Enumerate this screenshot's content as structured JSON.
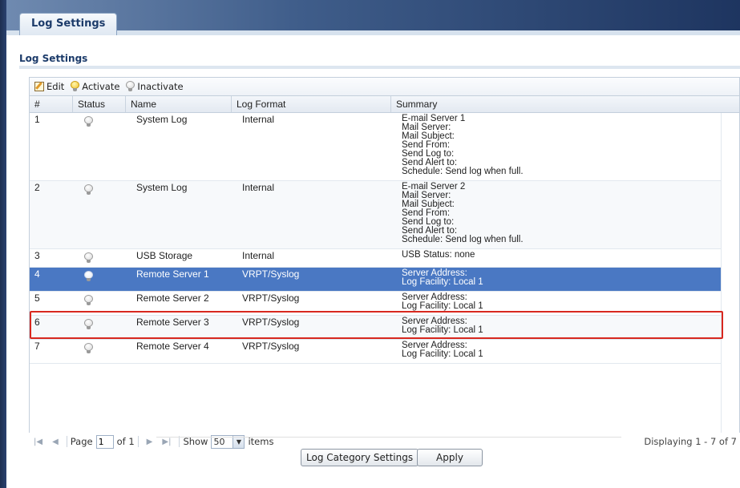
{
  "tab": {
    "label": "Log Settings"
  },
  "section": {
    "title": "Log Settings"
  },
  "toolbar": {
    "edit_label": "Edit",
    "activate_label": "Activate",
    "inactivate_label": "Inactivate"
  },
  "table": {
    "headers": [
      "#",
      "Status",
      "Name",
      "Log Format",
      "Summary"
    ],
    "rows": [
      {
        "num": "1",
        "status": "inactive",
        "name": "System Log",
        "format": "Internal",
        "summary": [
          "E-mail Server 1",
          "Mail Server:",
          "Mail Subject:",
          "Send From:",
          "Send Log to:",
          "Send Alert to:",
          "Schedule: Send log when full."
        ]
      },
      {
        "num": "2",
        "status": "inactive",
        "name": "System Log",
        "format": "Internal",
        "summary": [
          "E-mail Server 2",
          "Mail Server:",
          "Mail Subject:",
          "Send From:",
          "Send Log to:",
          "Send Alert to:",
          "Schedule: Send log when full."
        ]
      },
      {
        "num": "3",
        "status": "inactive",
        "name": "USB Storage",
        "format": "Internal",
        "summary": [
          "USB Status: none"
        ]
      },
      {
        "num": "4",
        "status": "inactive",
        "name": "Remote Server 1",
        "format": "VRPT/Syslog",
        "summary": [
          "Server Address:",
          "Log Facility: Local 1"
        ],
        "selected": true
      },
      {
        "num": "5",
        "status": "inactive",
        "name": "Remote Server 2",
        "format": "VRPT/Syslog",
        "summary": [
          "Server Address:",
          "Log Facility: Local 1"
        ]
      },
      {
        "num": "6",
        "status": "inactive",
        "name": "Remote Server 3",
        "format": "VRPT/Syslog",
        "summary": [
          "Server Address:",
          "Log Facility: Local 1"
        ]
      },
      {
        "num": "7",
        "status": "inactive",
        "name": "Remote Server 4",
        "format": "VRPT/Syslog",
        "summary": [
          "Server Address:",
          "Log Facility: Local 1"
        ]
      }
    ]
  },
  "pager": {
    "page_label": "Page",
    "page_value": "1",
    "of_label": "of 1",
    "show_label": "Show",
    "show_value": "50",
    "items_label": "items",
    "display_text": "Displaying 1 - 7 of 7"
  },
  "buttons": {
    "category_settings": "Log Category Settings",
    "apply": "Apply"
  },
  "colors": {
    "selected_row": "#4a78c3",
    "highlight_border": "#d8281f",
    "header_band": "#1e3560"
  }
}
